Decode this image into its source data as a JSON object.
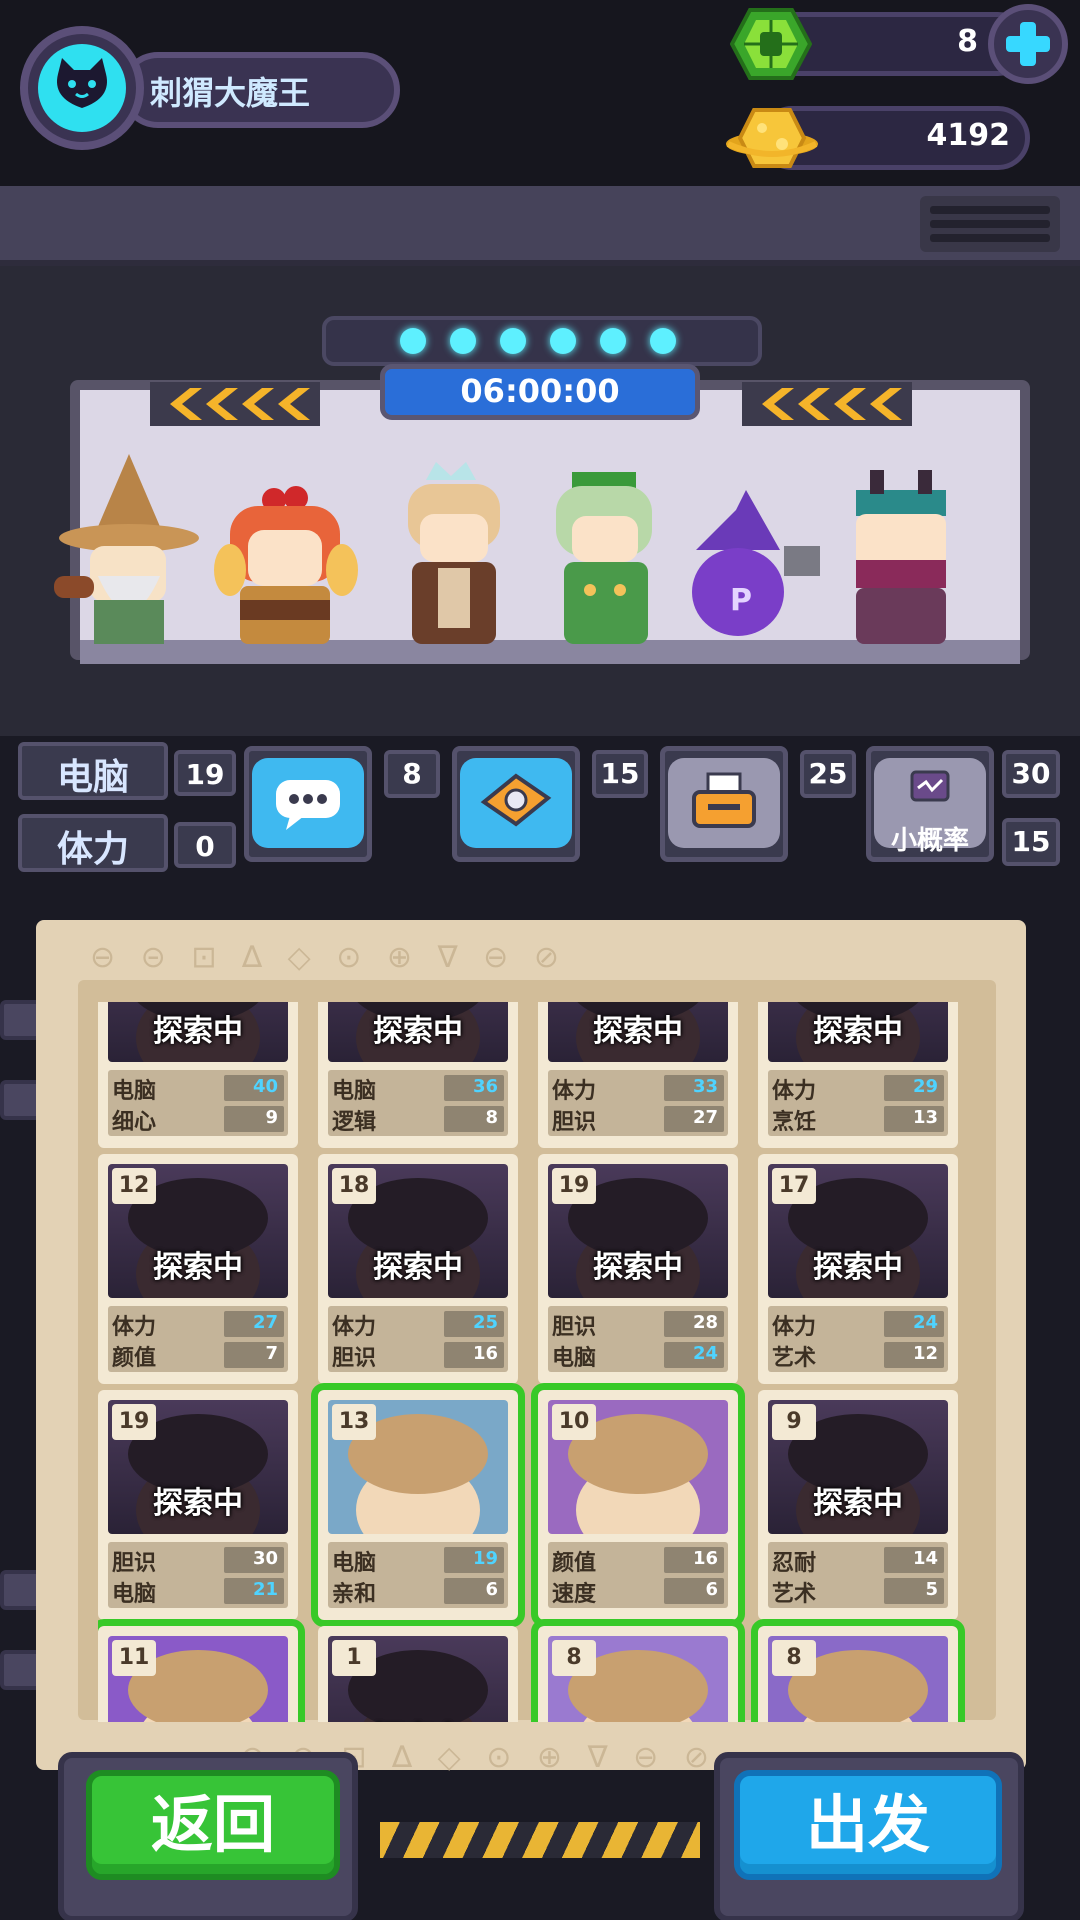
{
  "player": {
    "name": "刺猬大魔王"
  },
  "currency": {
    "gems": "8",
    "coins": "4192"
  },
  "expedition": {
    "timer": "06:00:00"
  },
  "requirements": {
    "computer": {
      "label": "电脑",
      "value": "19"
    },
    "stamina": {
      "label": "体力",
      "value": "0"
    }
  },
  "slots": [
    {
      "icon": "chat-bubble-icon",
      "value": "8",
      "caption": ""
    },
    {
      "icon": "disc-drive-icon",
      "value": "15",
      "caption": ""
    },
    {
      "icon": "printer-icon",
      "value": "25",
      "caption": ""
    },
    {
      "icon": "monitor-icon",
      "value": "30",
      "value2": "15",
      "caption": "小概率"
    }
  ],
  "cards": [
    {
      "level": "",
      "status": "探索中",
      "s1": "电脑",
      "v1": "40",
      "h1": true,
      "s2": "细心",
      "v2": "9",
      "h2": false
    },
    {
      "level": "",
      "status": "探索中",
      "s1": "电脑",
      "v1": "36",
      "h1": true,
      "s2": "逻辑",
      "v2": "8",
      "h2": false
    },
    {
      "level": "",
      "status": "探索中",
      "s1": "体力",
      "v1": "33",
      "h1": true,
      "s2": "胆识",
      "v2": "27",
      "h2": false
    },
    {
      "level": "",
      "status": "探索中",
      "s1": "体力",
      "v1": "29",
      "h1": true,
      "s2": "烹饪",
      "v2": "13",
      "h2": false
    },
    {
      "level": "12",
      "status": "探索中",
      "s1": "体力",
      "v1": "27",
      "h1": true,
      "s2": "颜值",
      "v2": "7",
      "h2": false
    },
    {
      "level": "18",
      "status": "探索中",
      "s1": "体力",
      "v1": "25",
      "h1": true,
      "s2": "胆识",
      "v2": "16",
      "h2": false
    },
    {
      "level": "19",
      "status": "探索中",
      "s1": "胆识",
      "v1": "28",
      "h1": false,
      "s2": "电脑",
      "v2": "24",
      "h2": true
    },
    {
      "level": "17",
      "status": "探索中",
      "s1": "体力",
      "v1": "24",
      "h1": true,
      "s2": "艺术",
      "v2": "12",
      "h2": false
    },
    {
      "level": "19",
      "status": "探索中",
      "s1": "胆识",
      "v1": "30",
      "h1": false,
      "s2": "电脑",
      "v2": "21",
      "h2": true
    },
    {
      "level": "13",
      "status": "",
      "s1": "电脑",
      "v1": "19",
      "h1": true,
      "s2": "亲和",
      "v2": "6",
      "h2": false,
      "selected": true
    },
    {
      "level": "10",
      "status": "",
      "s1": "颜值",
      "v1": "16",
      "h1": false,
      "s2": "速度",
      "v2": "6",
      "h2": false,
      "selected": true
    },
    {
      "level": "9",
      "status": "探索中",
      "s1": "忍耐",
      "v1": "14",
      "h1": false,
      "s2": "艺术",
      "v2": "5",
      "h2": false
    },
    {
      "level": "11",
      "status": "",
      "s1": "",
      "v1": "",
      "s2": "",
      "v2": "",
      "selected": true
    },
    {
      "level": "1",
      "status": "探索中",
      "s1": "",
      "v1": "",
      "s2": "",
      "v2": ""
    },
    {
      "level": "8",
      "status": "",
      "s1": "",
      "v1": "",
      "s2": "",
      "v2": "",
      "selected": true
    },
    {
      "level": "8",
      "status": "",
      "s1": "",
      "v1": "",
      "s2": "",
      "v2": "",
      "selected": true
    }
  ],
  "buttons": {
    "back": "返回",
    "go": "出发"
  },
  "colors": {
    "accent_cyan": "#2fe0f0",
    "select_green": "#38c928",
    "highlight_stat": "#4fd3ff"
  }
}
